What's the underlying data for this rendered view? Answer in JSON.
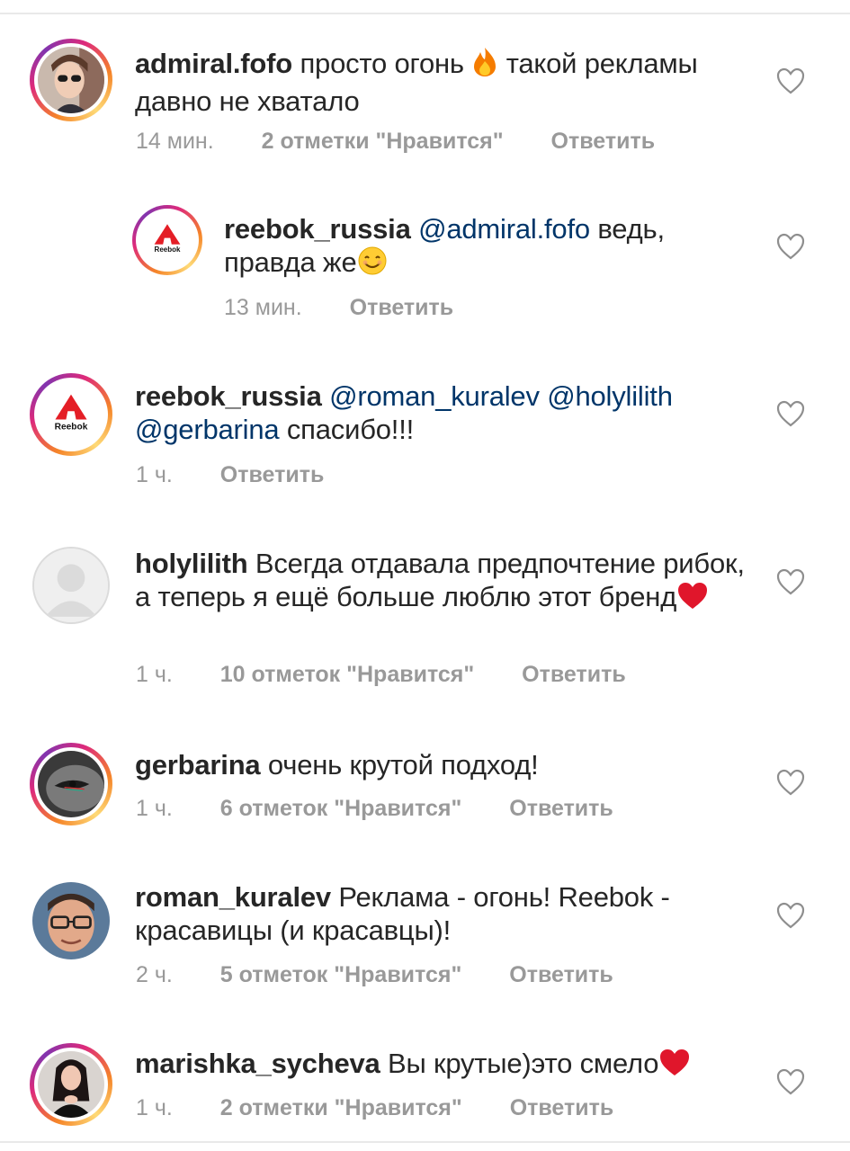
{
  "comments": [
    {
      "username": "admiral.fofo",
      "text_parts": [
        "просто огонь ",
        " такой рекламы давно не хватало"
      ],
      "time": "14 мин.",
      "likes": "2 отметки \"Нравится\"",
      "reply": "Ответить"
    },
    {
      "username": "reebok_russia",
      "mentions": [
        "@admiral.fofo"
      ],
      "text": " ведь, правда же",
      "time": "13 мин.",
      "reply": "Ответить",
      "avatar_logo": "Reebok"
    },
    {
      "username": "reebok_russia",
      "mentions": [
        "@roman_kuralev",
        "@holylilith",
        "@gerbarina"
      ],
      "text": " спасибо!!!",
      "time": "1 ч.",
      "reply": "Ответить",
      "avatar_logo": "Reebok"
    },
    {
      "username": "holylilith",
      "text": "Всегда отдавала предпочтение рибок, а теперь я ещё больше люблю этот бренд",
      "time": "1 ч.",
      "likes": "10 отметок \"Нравится\"",
      "reply": "Ответить"
    },
    {
      "username": "gerbarina",
      "text": "очень крутой подход!",
      "time": "1 ч.",
      "likes": "6 отметок \"Нравится\"",
      "reply": "Ответить"
    },
    {
      "username": "roman_kuralev",
      "text": "Реклама - огонь! Reebok - красавицы (и красавцы)!",
      "time": "2 ч.",
      "likes": "5 отметок \"Нравится\"",
      "reply": "Ответить"
    },
    {
      "username": "marishka_sycheva",
      "text": "Вы крутые)это смело",
      "time": "1 ч.",
      "likes": "2 отметки \"Нравится\"",
      "reply": "Ответить"
    }
  ],
  "icons": {
    "like": "heart-outline-icon",
    "fire": "fire-emoji",
    "smile": "smiling-face-emoji",
    "heart": "red-heart-emoji"
  },
  "colors": {
    "mention": "#003569",
    "meta": "#999999",
    "text": "#262626"
  }
}
